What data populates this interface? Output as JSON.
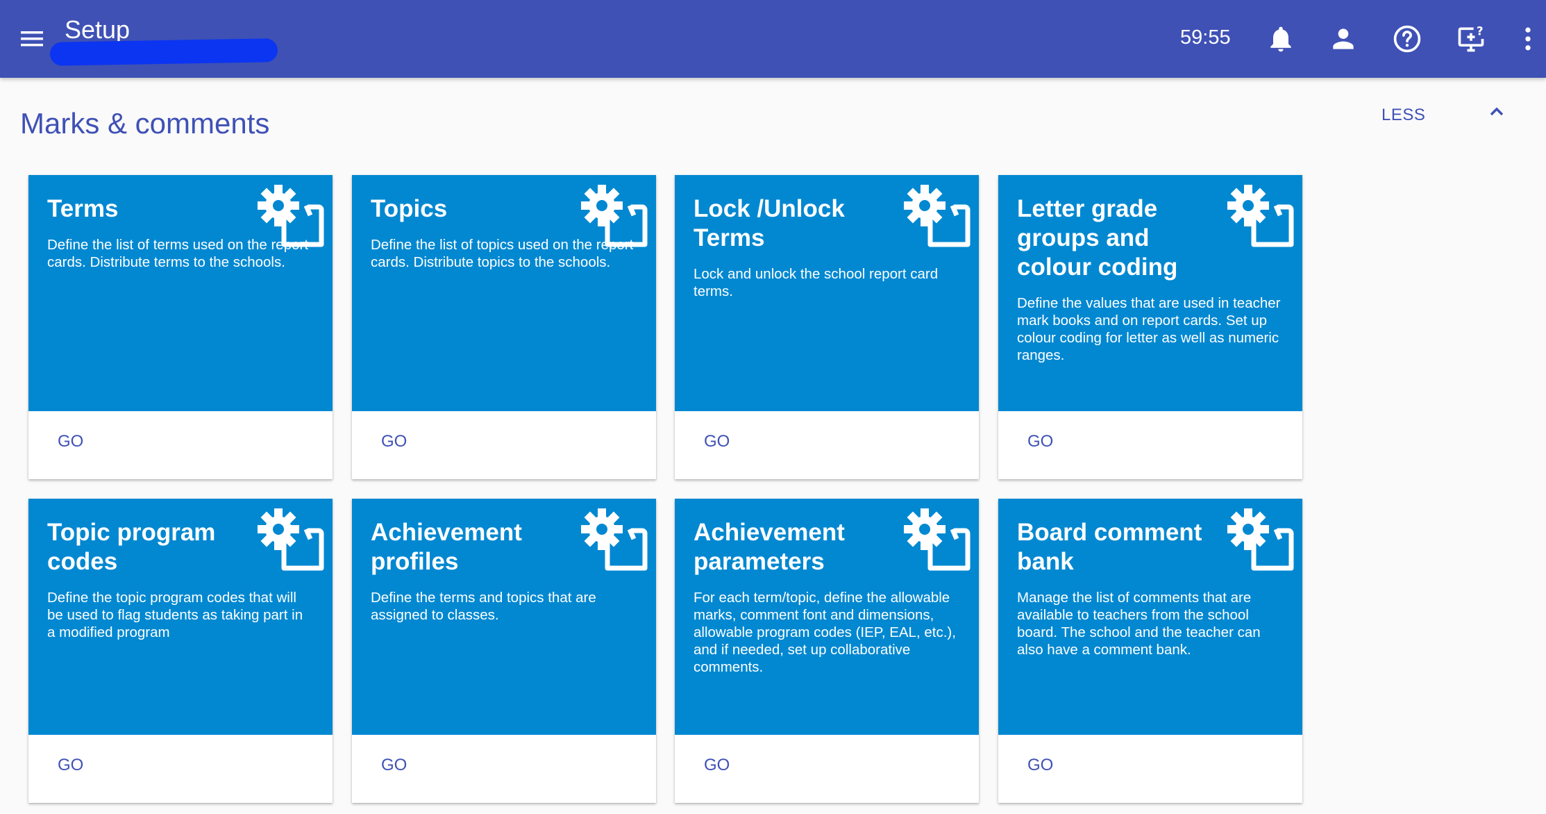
{
  "header": {
    "title": "Setup",
    "timer": "59:55",
    "icons": [
      "menu-icon",
      "bell-icon",
      "person-icon",
      "help-icon",
      "screen-help-icon",
      "more-vert-icon"
    ]
  },
  "section": {
    "title": "Marks & comments",
    "toggle_label": "LESS"
  },
  "cards": [
    {
      "title": "Terms",
      "description": "Define the list of terms used on the report cards. Distribute terms to the schools.",
      "button": "GO"
    },
    {
      "title": "Topics",
      "description": "Define the list of topics used on the report cards. Distribute topics to the schools.",
      "button": "GO"
    },
    {
      "title": "Lock /Unlock Terms",
      "description": "Lock and unlock the school report card terms.",
      "button": "GO"
    },
    {
      "title": "Letter grade groups and colour coding",
      "description": "Define the values that are used in teacher mark books and on report cards. Set up colour coding for letter as well as numeric ranges.",
      "button": "GO"
    },
    {
      "title": "Topic program codes",
      "description": "Define the topic program codes that will be used to flag students as taking part in a modified program",
      "button": "GO"
    },
    {
      "title": "Achievement profiles",
      "description": "Define the terms and topics that are assigned to classes.",
      "button": "GO"
    },
    {
      "title": "Achievement parameters",
      "description": "For each term/topic, define the allowable marks, comment font and dimensions, allowable program codes (IEP, EAL, etc.), and if needed, set up collaborative comments.",
      "button": "GO"
    },
    {
      "title": "Board comment bank",
      "description": "Manage the list of comments that are available to teachers from the school board. The school and the teacher can also have a comment bank.",
      "button": "GO"
    }
  ],
  "colors": {
    "app_bar": "#3f51b5",
    "card_blue": "#0288d1",
    "accent_text": "#3f51b5",
    "page_bg": "#fafafa"
  }
}
